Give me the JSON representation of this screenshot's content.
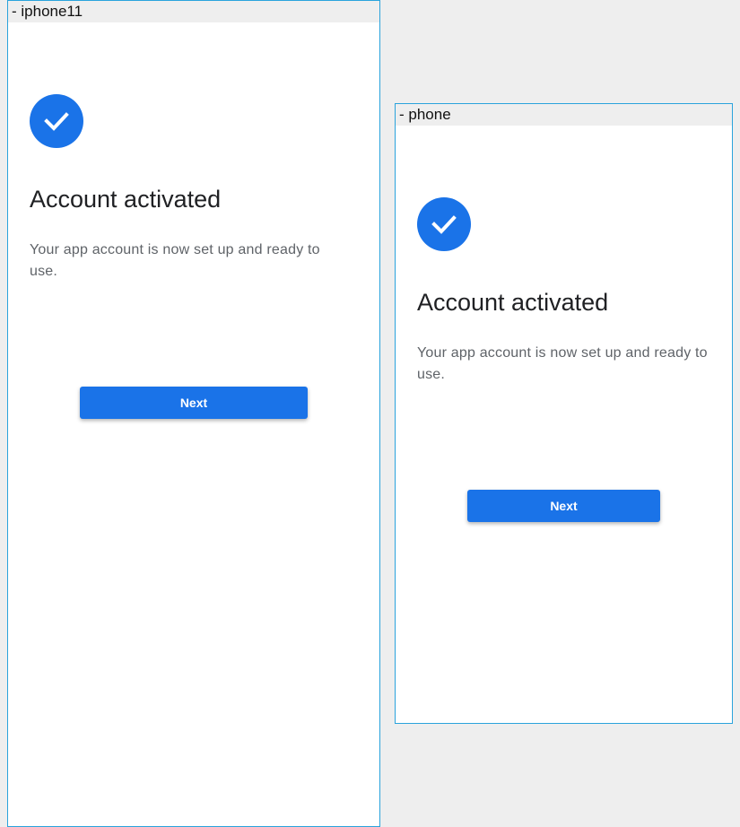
{
  "colors": {
    "accent": "#1a73e8",
    "frame_border": "#2aa3dc",
    "canvas_background": "#eeeeee"
  },
  "frames": [
    {
      "label": "- iphone11",
      "icon": "check-icon",
      "title": "Account activated",
      "subtitle": "Your app account is now set up and ready to use.",
      "button_label": "Next"
    },
    {
      "label": "- phone",
      "icon": "check-icon",
      "title": "Account activated",
      "subtitle": "Your app account is now set up and ready to use.",
      "button_label": "Next"
    }
  ]
}
